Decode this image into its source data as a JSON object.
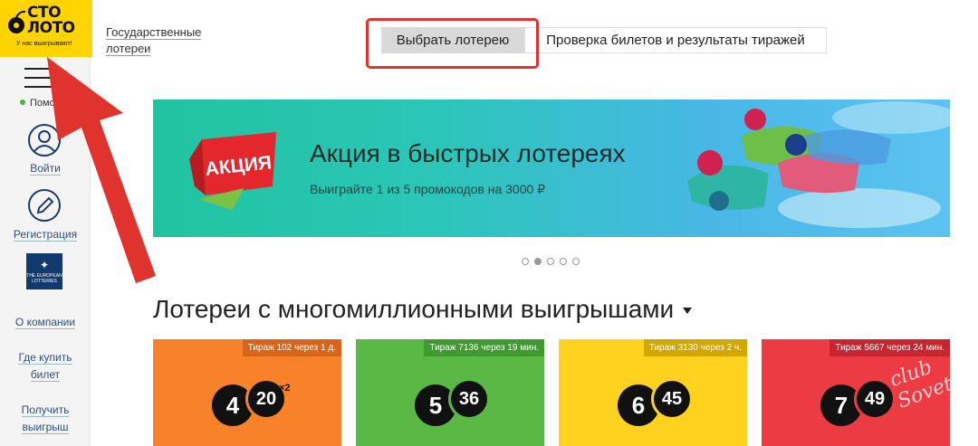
{
  "logo": {
    "line1": "СТО",
    "line2": "ЛОТО",
    "tagline": "У нас выигрывают!"
  },
  "sidebar": {
    "help": "Помощь",
    "login": "Войти",
    "register": "Регистрация",
    "el_logo": "THE EUROPEAN LOTTERIES",
    "about": "О компании",
    "where_buy": [
      "Где купить",
      "билет"
    ],
    "get_prize": [
      "Получить",
      "выигрыш"
    ]
  },
  "header": {
    "gos": [
      "Государственные",
      "лотереи"
    ],
    "select_lottery": "Выбрать лотерею",
    "check_tickets": "Проверка билетов и результаты тиражей"
  },
  "banner": {
    "badge": "АКЦИЯ",
    "title": "Акция в быстрых лотереях",
    "subtitle": "Выиграйте 1 из 5 промокодов на 3000 ₽",
    "slides": 5,
    "active_slide": 2
  },
  "section": {
    "title": "Лотереи с многомиллионными выигрышами"
  },
  "cards": [
    {
      "draw": "Тираж 102 через 1 д.",
      "n1": "4",
      "n2": "20",
      "mult": "×2",
      "bg": "#f7822a",
      "tag": "#d8661a"
    },
    {
      "draw": "Тираж 7136 через 19 мин.",
      "n1": "5",
      "n2": "36",
      "mult": "",
      "bg": "#5ab845",
      "tag": "#3f9a30"
    },
    {
      "draw": "Тираж 3130 через 2 ч.",
      "n1": "6",
      "n2": "45",
      "mult": "",
      "bg": "#ffd21f",
      "tag": "#d2a800"
    },
    {
      "draw": "Тираж 5667 через 24 мин.",
      "n1": "7",
      "n2": "49",
      "mult": "",
      "bg": "#ec3b43",
      "tag": "#c62630"
    }
  ],
  "watermark": "club Sovet",
  "colors": {
    "brand_yellow": "#ffd400",
    "highlight_red": "#e0332e",
    "nav_blue": "#2c4f7c"
  }
}
